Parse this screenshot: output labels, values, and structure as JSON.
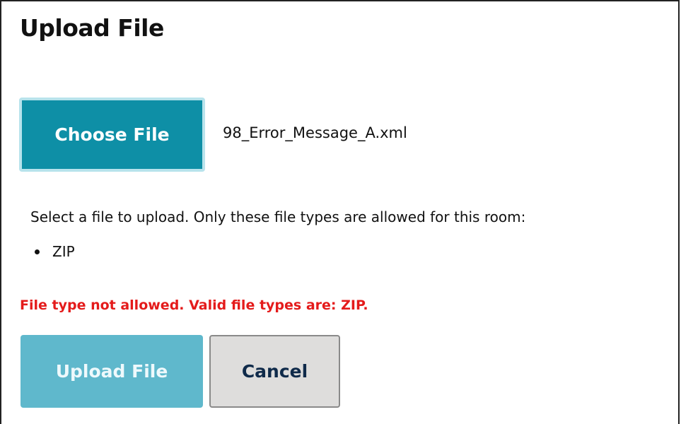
{
  "dialog": {
    "title": "Upload File"
  },
  "file_picker": {
    "choose_label": "Choose File",
    "selected_file": "98_Error_Message_A.xml"
  },
  "instructions": {
    "text": "Select a file to upload. Only these file types are allowed for this room:",
    "allowed_types": [
      "ZIP"
    ]
  },
  "error": {
    "message": "File type not allowed. Valid file types are: ZIP."
  },
  "actions": {
    "upload_label": "Upload File",
    "cancel_label": "Cancel"
  },
  "colors": {
    "choose_button": "#0e8fa6",
    "upload_button_disabled": "#5fb8cc",
    "cancel_button": "#dedddc",
    "error_text": "#e41b1b"
  }
}
